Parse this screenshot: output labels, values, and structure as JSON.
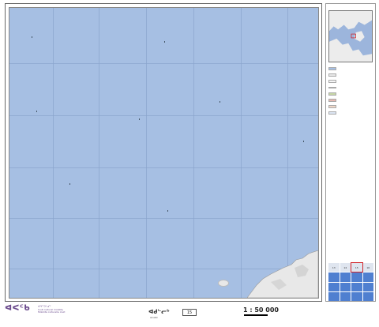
{
  "map": {
    "top_ticks": [
      "",
      "",
      "",
      "",
      "",
      ""
    ],
    "bottom_ticks": [
      "",
      "",
      "",
      "",
      "",
      ""
    ],
    "place_label": ""
  },
  "sidebar": {
    "title": "",
    "subtitle": "",
    "paragraphs": [
      "",
      "",
      ""
    ],
    "legend_title": "",
    "legend_items": [
      "",
      "",
      "",
      "",
      "",
      "",
      "",
      "",
      "",
      "",
      "",
      ""
    ],
    "index_cells": [
      "13",
      "14",
      "15",
      "16",
      "",
      "",
      "",
      "",
      "",
      "",
      "",
      "",
      "",
      "",
      "",
      ""
    ],
    "current_sheet": "15"
  },
  "footer": {
    "logo_glyph": "ᐊᐸᑦᑲ",
    "logo_lines": [
      "ᐊᖏᑦᑐᕐᓗᒋᑦ",
      "Inuit cultural mobility",
      "Mobilité culturelle inuit"
    ],
    "map_title": "ᐊᑯᓪᓕᒃ",
    "map_subtitle": "Akullik",
    "sheet_number": "15",
    "scale": "1 : 50 000",
    "scale_units": "",
    "left_note": "",
    "right_note": ""
  },
  "colors": {
    "water": "#a6bfe3",
    "land": "#e8e8e8",
    "index_water": "#4f7fd0",
    "current_outline": "#d1242a",
    "logo": "#6a4a8c"
  }
}
